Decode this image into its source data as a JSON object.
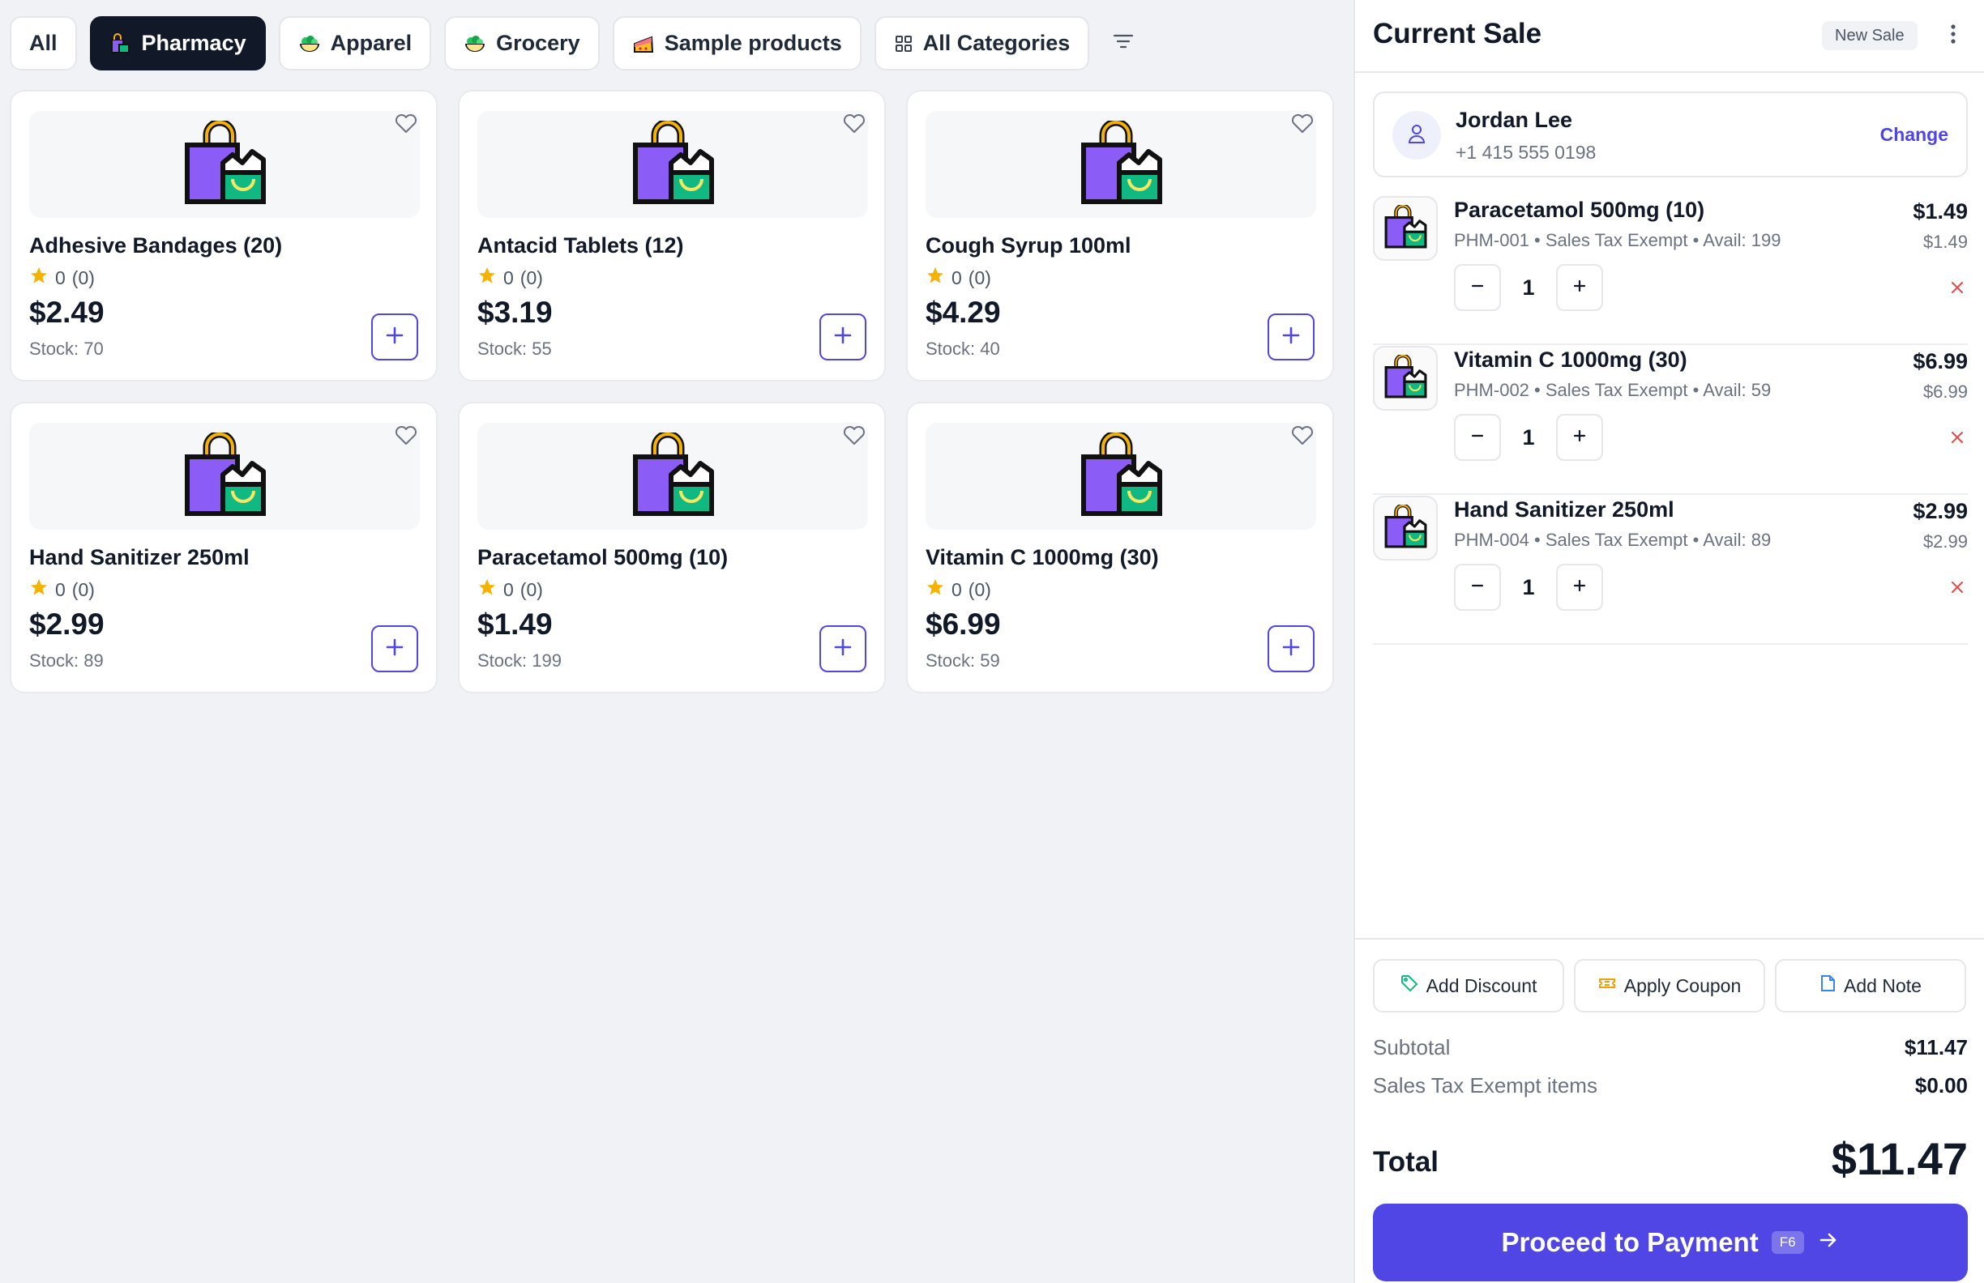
{
  "categories": {
    "tabs": [
      {
        "label": "All",
        "icon": "",
        "active": false
      },
      {
        "label": "Pharmacy",
        "icon": "shopping-bags-icon",
        "active": true
      },
      {
        "label": "Apparel",
        "icon": "salad-bowl-icon",
        "active": false
      },
      {
        "label": "Grocery",
        "icon": "salad-bowl-icon",
        "active": false
      },
      {
        "label": "Sample products",
        "icon": "cake-slice-icon",
        "active": false
      },
      {
        "label": "All Categories",
        "icon": "grid-icon",
        "active": false
      }
    ]
  },
  "products": [
    {
      "name": "Adhesive Bandages (20)",
      "rating": "0",
      "reviews": "(0)",
      "price": "$2.49",
      "stock": "Stock: 70"
    },
    {
      "name": "Antacid Tablets (12)",
      "rating": "0",
      "reviews": "(0)",
      "price": "$3.19",
      "stock": "Stock: 55"
    },
    {
      "name": "Cough Syrup 100ml",
      "rating": "0",
      "reviews": "(0)",
      "price": "$4.29",
      "stock": "Stock: 40"
    },
    {
      "name": "Hand Sanitizer 250ml",
      "rating": "0",
      "reviews": "(0)",
      "price": "$2.99",
      "stock": "Stock: 89"
    },
    {
      "name": "Paracetamol 500mg (10)",
      "rating": "0",
      "reviews": "(0)",
      "price": "$1.49",
      "stock": "Stock: 199"
    },
    {
      "name": "Vitamin C 1000mg (30)",
      "rating": "0",
      "reviews": "(0)",
      "price": "$6.99",
      "stock": "Stock: 59"
    }
  ],
  "sale": {
    "title": "Current Sale",
    "new_sale_label": "New Sale",
    "customer": {
      "name": "Jordan Lee",
      "phone": "+1 415 555 0198",
      "change_label": "Change"
    },
    "items": [
      {
        "name": "Paracetamol 500mg (10)",
        "meta": "PHM-001 • Sales Tax Exempt • Avail: 199",
        "total": "$1.49",
        "unit": "$1.49",
        "qty": "1"
      },
      {
        "name": "Vitamin C 1000mg (30)",
        "meta": "PHM-002 • Sales Tax Exempt • Avail: 59",
        "total": "$6.99",
        "unit": "$6.99",
        "qty": "1"
      },
      {
        "name": "Hand Sanitizer 250ml",
        "meta": "PHM-004 • Sales Tax Exempt • Avail: 89",
        "total": "$2.99",
        "unit": "$2.99",
        "qty": "1"
      }
    ],
    "actions": {
      "discount": "Add Discount",
      "coupon": "Apply Coupon",
      "note": "Add Note"
    },
    "summary": {
      "subtotal_label": "Subtotal",
      "subtotal": "$11.47",
      "tax_label": "Sales Tax Exempt items",
      "tax": "$0.00",
      "total_label": "Total",
      "total": "$11.47"
    },
    "pay": {
      "label": "Proceed to Payment",
      "shortcut": "F6"
    }
  },
  "colors": {
    "accent": "#4f46e5",
    "dark": "#111827",
    "star": "#f5b301",
    "remove": "#ef4444"
  }
}
